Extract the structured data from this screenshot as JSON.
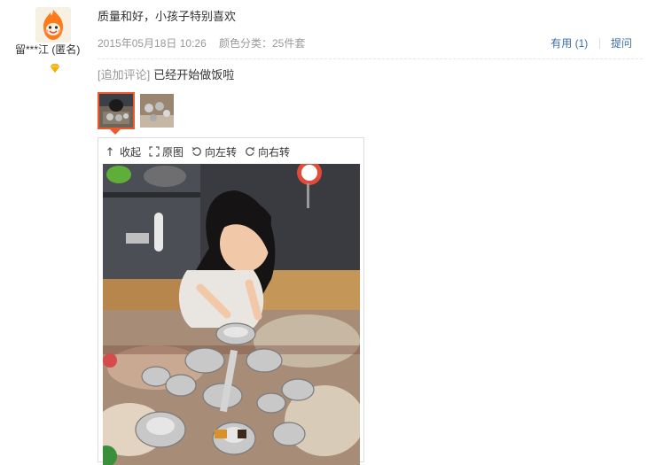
{
  "user": {
    "name": "留***江 (匿名)",
    "avatar_icon": "cartoon-flame-avatar-icon",
    "level_badge_icon": "gold-diamond-icon"
  },
  "review": {
    "content": "质量和好，小孩子特别喜欢",
    "date": "2015年05月18日 10:26",
    "sku": "颜色分类：25件套",
    "useful_label": "有用",
    "useful_count": "(1)",
    "reply_label": "提问",
    "append_tag": "[追加评论]",
    "append_content": "已经开始做饭啦"
  },
  "viewer": {
    "collapse_label": "收起",
    "original_label": "原图",
    "rotate_left_label": "向左转",
    "rotate_right_label": "向右转"
  },
  "colors": {
    "accent": "#f0592b",
    "link": "#3c6ea8",
    "muted": "#999999"
  }
}
